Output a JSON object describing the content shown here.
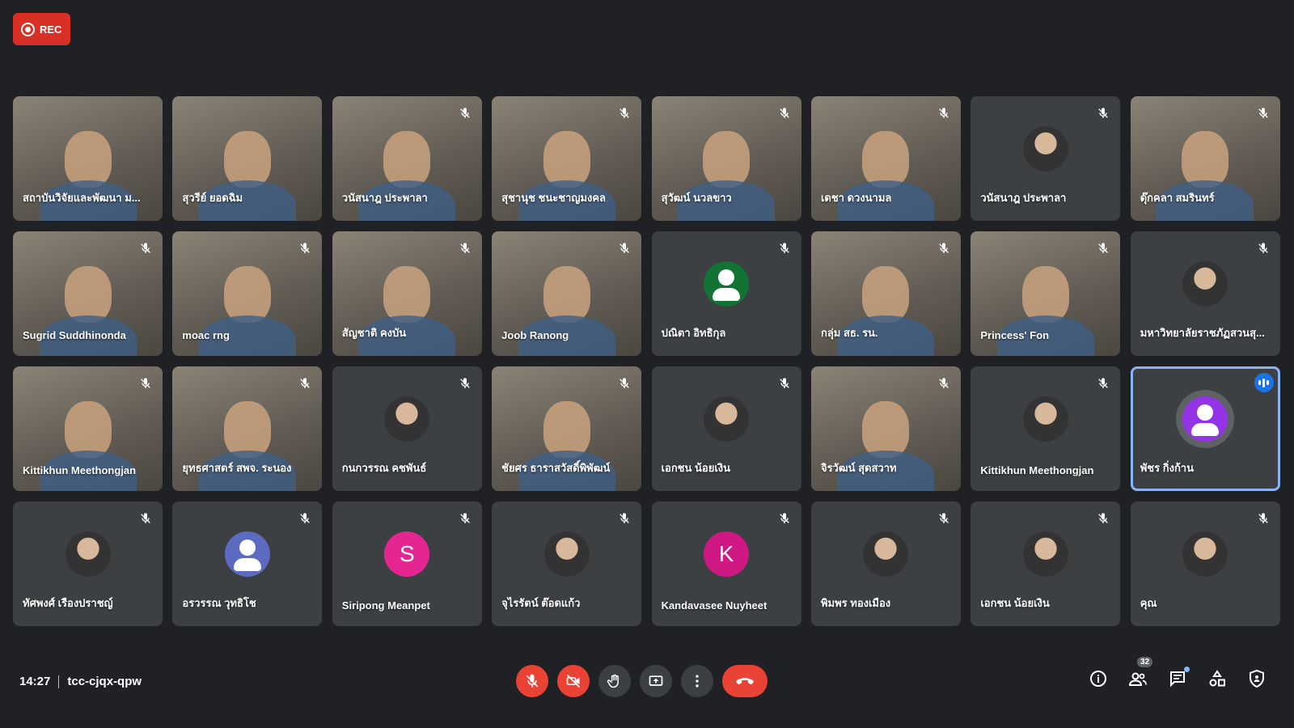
{
  "recording": {
    "label": "REC",
    "color": "#d93025"
  },
  "meeting": {
    "time": "14:27",
    "code": "tcc-cjqx-qpw"
  },
  "participants_count": "32",
  "tiles": [
    {
      "name": "สถาบันวิจัยและพัฒนา ม...",
      "type": "video",
      "muted": false
    },
    {
      "name": "สุวรีย์ ยอดฉิม",
      "type": "video",
      "muted": false
    },
    {
      "name": "วนัสนาฎ ประพาลา",
      "type": "video",
      "muted": true
    },
    {
      "name": "สุชานุช ชนะชาญมงคล",
      "type": "video",
      "muted": true
    },
    {
      "name": "สุวัฒน์ นวลขาว",
      "type": "video",
      "muted": true
    },
    {
      "name": "เดชา ดวงนามล",
      "type": "video",
      "muted": true
    },
    {
      "name": "วนัสนาฎ ประพาลา",
      "type": "photo",
      "muted": true
    },
    {
      "name": "ดุ๊กคลา สมรินทร์",
      "type": "video",
      "muted": true
    },
    {
      "name": "Sugrid Suddhinonda",
      "type": "video",
      "muted": true
    },
    {
      "name": "moac rng",
      "type": "video",
      "muted": true
    },
    {
      "name": "สัญชาติ คงบัน",
      "type": "video",
      "muted": true
    },
    {
      "name": "Joob Ranong",
      "type": "video",
      "muted": true
    },
    {
      "name": "ปณิตา อิทธิกุล",
      "type": "icon",
      "color": "#137333",
      "muted": true
    },
    {
      "name": "กลุ่ม สธ. รน.",
      "type": "video",
      "muted": true
    },
    {
      "name": "Princess' Fon",
      "type": "video",
      "muted": true
    },
    {
      "name": "มหาวิทยาลัยราชภัฏสวนสุ...",
      "type": "photo",
      "muted": true
    },
    {
      "name": "Kittikhun Meethongjan",
      "type": "video",
      "muted": true
    },
    {
      "name": "ยุทธศาสตร์ สพจ. ระนอง",
      "type": "video",
      "muted": true
    },
    {
      "name": "กนกวรรณ คชพันธ์",
      "type": "photo",
      "muted": true
    },
    {
      "name": "ชัยศร ธาราสวัสดิ์พิพัฒน์",
      "type": "video",
      "muted": true
    },
    {
      "name": "เอกชน น้อยเงิน",
      "type": "photo",
      "muted": true
    },
    {
      "name": "จิรวัฒน์ สุดสวาท",
      "type": "video",
      "muted": true
    },
    {
      "name": "Kittikhun Meethongjan",
      "type": "photo",
      "muted": true
    },
    {
      "name": "พัชร กิ่งก้าน",
      "type": "icon",
      "color": "#9334e6",
      "muted": false,
      "speaking": true
    },
    {
      "name": "ทัศพงศ์ เรืองปราชญ์",
      "type": "photo",
      "muted": true
    },
    {
      "name": "อรวรรณ วุทธิโช",
      "type": "icon",
      "color": "#5c6bc0",
      "muted": true
    },
    {
      "name": "Siripong Meanpet",
      "type": "letter",
      "letter": "S",
      "color": "#e52592",
      "muted": true
    },
    {
      "name": "จุไรรัตน์ ต๊อดแก้ว",
      "type": "photo",
      "muted": true
    },
    {
      "name": "Kandavasee Nuyheet",
      "type": "letter",
      "letter": "K",
      "color": "#d01884",
      "muted": true
    },
    {
      "name": "พิมพร ทองเมือง",
      "type": "photo",
      "muted": true
    },
    {
      "name": "เอกชน น้อยเงิน",
      "type": "photo",
      "muted": true
    },
    {
      "name": "คุณ",
      "type": "photo",
      "muted": true
    }
  ],
  "controls": {
    "mic": "mic-off-icon",
    "camera": "camera-off-icon",
    "hand": "raise-hand-icon",
    "present": "present-screen-icon",
    "more": "more-options-icon",
    "leave": "leave-call-icon"
  },
  "side_controls": [
    "info-icon",
    "people-icon",
    "chat-icon",
    "activities-icon",
    "host-controls-icon"
  ]
}
